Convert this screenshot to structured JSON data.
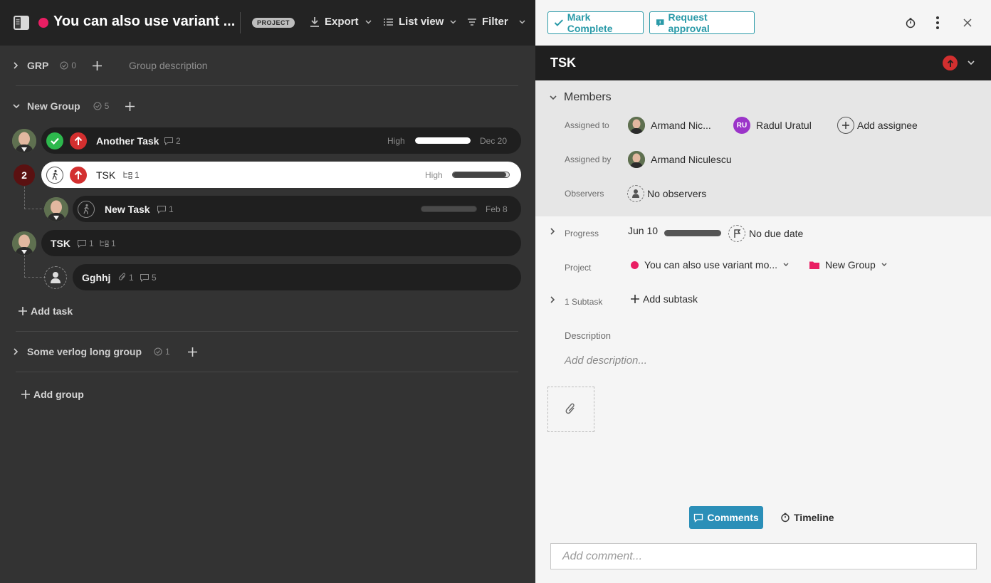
{
  "topbar": {
    "project_title": "You can also use variant ...",
    "project_badge": "PROJECT",
    "project_color": "#e91e63",
    "export_label": "Export",
    "view_label": "List view",
    "filter_label": "Filter"
  },
  "groups": [
    {
      "name": "GRP",
      "count": "0",
      "description": "Group description"
    },
    {
      "name": "New Group",
      "count": "5"
    },
    {
      "name": "Some verlog long group",
      "count": "1"
    }
  ],
  "tasks": {
    "another": {
      "name": "Another Task",
      "comments": "2",
      "priority": "High",
      "progress": 1.0,
      "due": "Dec 20"
    },
    "tsk_selected": {
      "name": "TSK",
      "subtasks": "1",
      "priority": "High",
      "progress": 0.95,
      "badge": "2"
    },
    "new_task": {
      "name": "New Task",
      "comments": "1",
      "progress": 0.0,
      "due": "Feb 8"
    },
    "tsk2": {
      "name": "TSK",
      "comments": "1",
      "subtasks": "1"
    },
    "gghhj": {
      "name": "Gghhj",
      "attachments": "1",
      "comments": "5"
    }
  },
  "add_task_label": "Add task",
  "add_group_label": "Add group",
  "panel": {
    "mark_complete": "Mark Complete",
    "request_approval": "Request approval",
    "title": "TSK",
    "members_label": "Members",
    "assigned_to_label": "Assigned to",
    "assignee1": "Armand Nic...",
    "assignee2": "Radul Uratul",
    "assignee2_initials": "RU",
    "add_assignee": "Add assignee",
    "assigned_by_label": "Assigned by",
    "assigned_by": "Armand Niculescu",
    "observers_label": "Observers",
    "observers_value": "No observers",
    "progress_label": "Progress",
    "start_date": "Jun 10",
    "due_date": "No due date",
    "project_label": "Project",
    "project_value": "You can also use variant mo...",
    "group_value": "New Group",
    "group_color": "#e91e63",
    "subtask_label": "1 Subtask",
    "add_subtask": "Add subtask",
    "description_label": "Description",
    "description_placeholder": "Add description...",
    "tab_comments": "Comments",
    "tab_timeline": "Timeline",
    "comment_placeholder": "Add comment..."
  },
  "colors": {
    "accent": "#2a9aa8",
    "priority_high": "#d32f2f",
    "done": "#2db84d",
    "comments_tab": "#2b8fb8"
  }
}
